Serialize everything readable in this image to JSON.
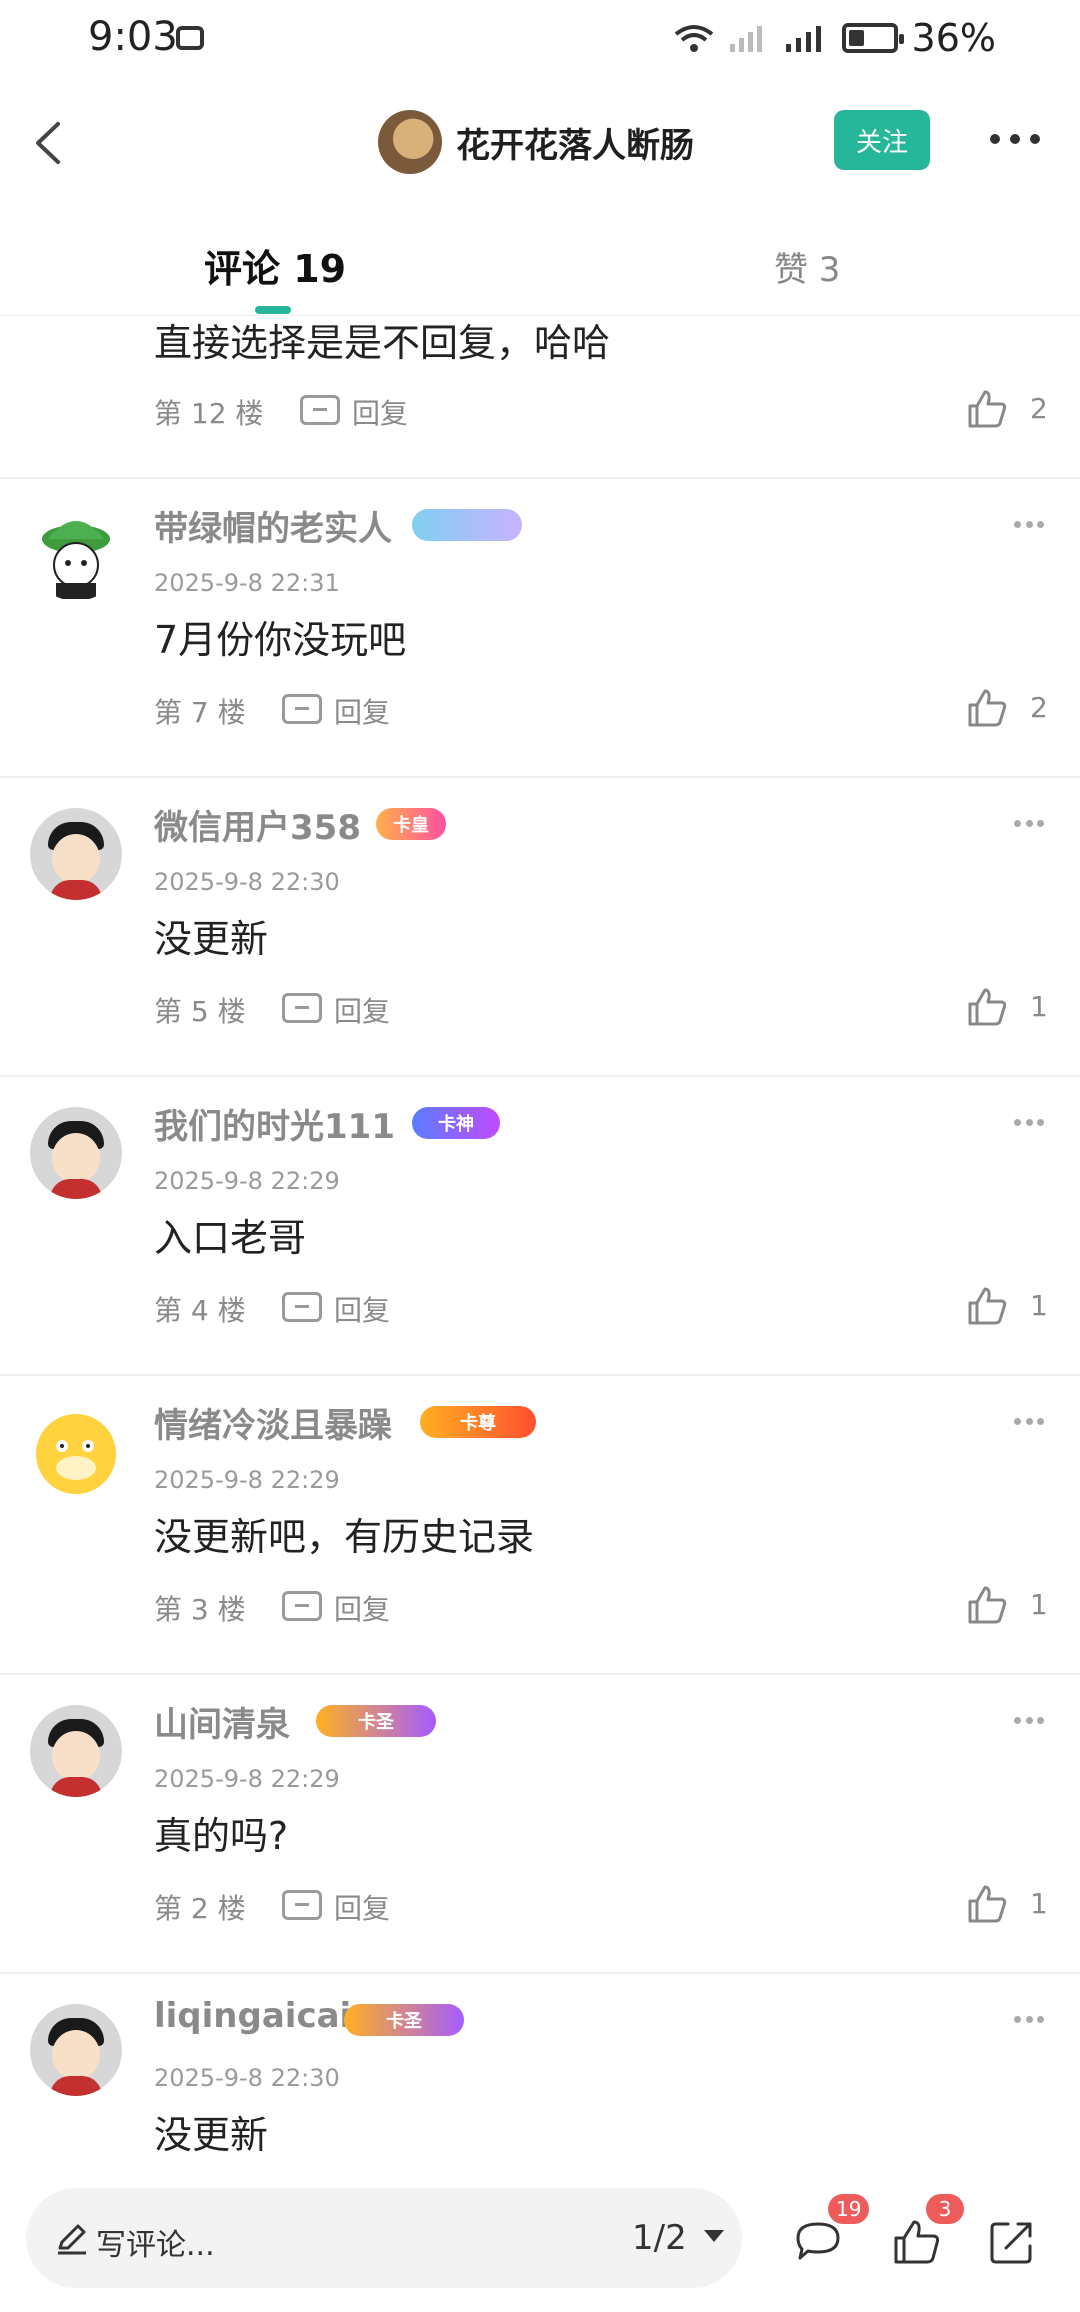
{
  "status_bar": {
    "time": "9:03",
    "battery_percent": "36%",
    "battery_level": 0.36
  },
  "header": {
    "title": "花开花落人断肠",
    "follow_label": "关注"
  },
  "tabs": [
    {
      "label": "评论 19",
      "active": true
    },
    {
      "label": "赞 3",
      "active": false
    }
  ],
  "comments": [
    {
      "username": "",
      "badge": "",
      "date": "",
      "text": "直接选择是是不回复，哈哈",
      "floor": "第 12 楼",
      "reply_label": "回复",
      "likes": "2"
    },
    {
      "username": "带绿帽的老实人",
      "badge": "",
      "date": "2025-9-8 22:31",
      "text": "7月份你没玩吧",
      "floor": "第 7 楼",
      "reply_label": "回复",
      "likes": "2"
    },
    {
      "username": "微信用户358",
      "badge": "卡皇",
      "date": "2025-9-8 22:30",
      "text": "没更新",
      "floor": "第 5 楼",
      "reply_label": "回复",
      "likes": "1"
    },
    {
      "username": "我们的时光111",
      "badge": "卡神",
      "date": "2025-9-8 22:29",
      "text": "入口老哥",
      "floor": "第 4 楼",
      "reply_label": "回复",
      "likes": "1"
    },
    {
      "username": "情绪冷淡且暴躁",
      "badge": "卡尊",
      "date": "2025-9-8 22:29",
      "text": "没更新吧，有历史记录",
      "floor": "第 3 楼",
      "reply_label": "回复",
      "likes": "1"
    },
    {
      "username": "山间清泉",
      "badge": "卡圣",
      "date": "2025-9-8 22:29",
      "text": "真的吗?",
      "floor": "第 2 楼",
      "reply_label": "回复",
      "likes": "1"
    },
    {
      "username": "liqingaicai",
      "badge": "卡圣",
      "date": "2025-9-8 22:30",
      "text": "没更新",
      "floor": "",
      "reply_label": "",
      "likes": ""
    }
  ],
  "bottom_bar": {
    "comment_placeholder": "写评论...",
    "page_indicator": "1/2",
    "comments_count": "19",
    "likes_count": "3"
  },
  "colors": {
    "accent": "#26b79a",
    "badge_red": "#ee5b5b"
  }
}
